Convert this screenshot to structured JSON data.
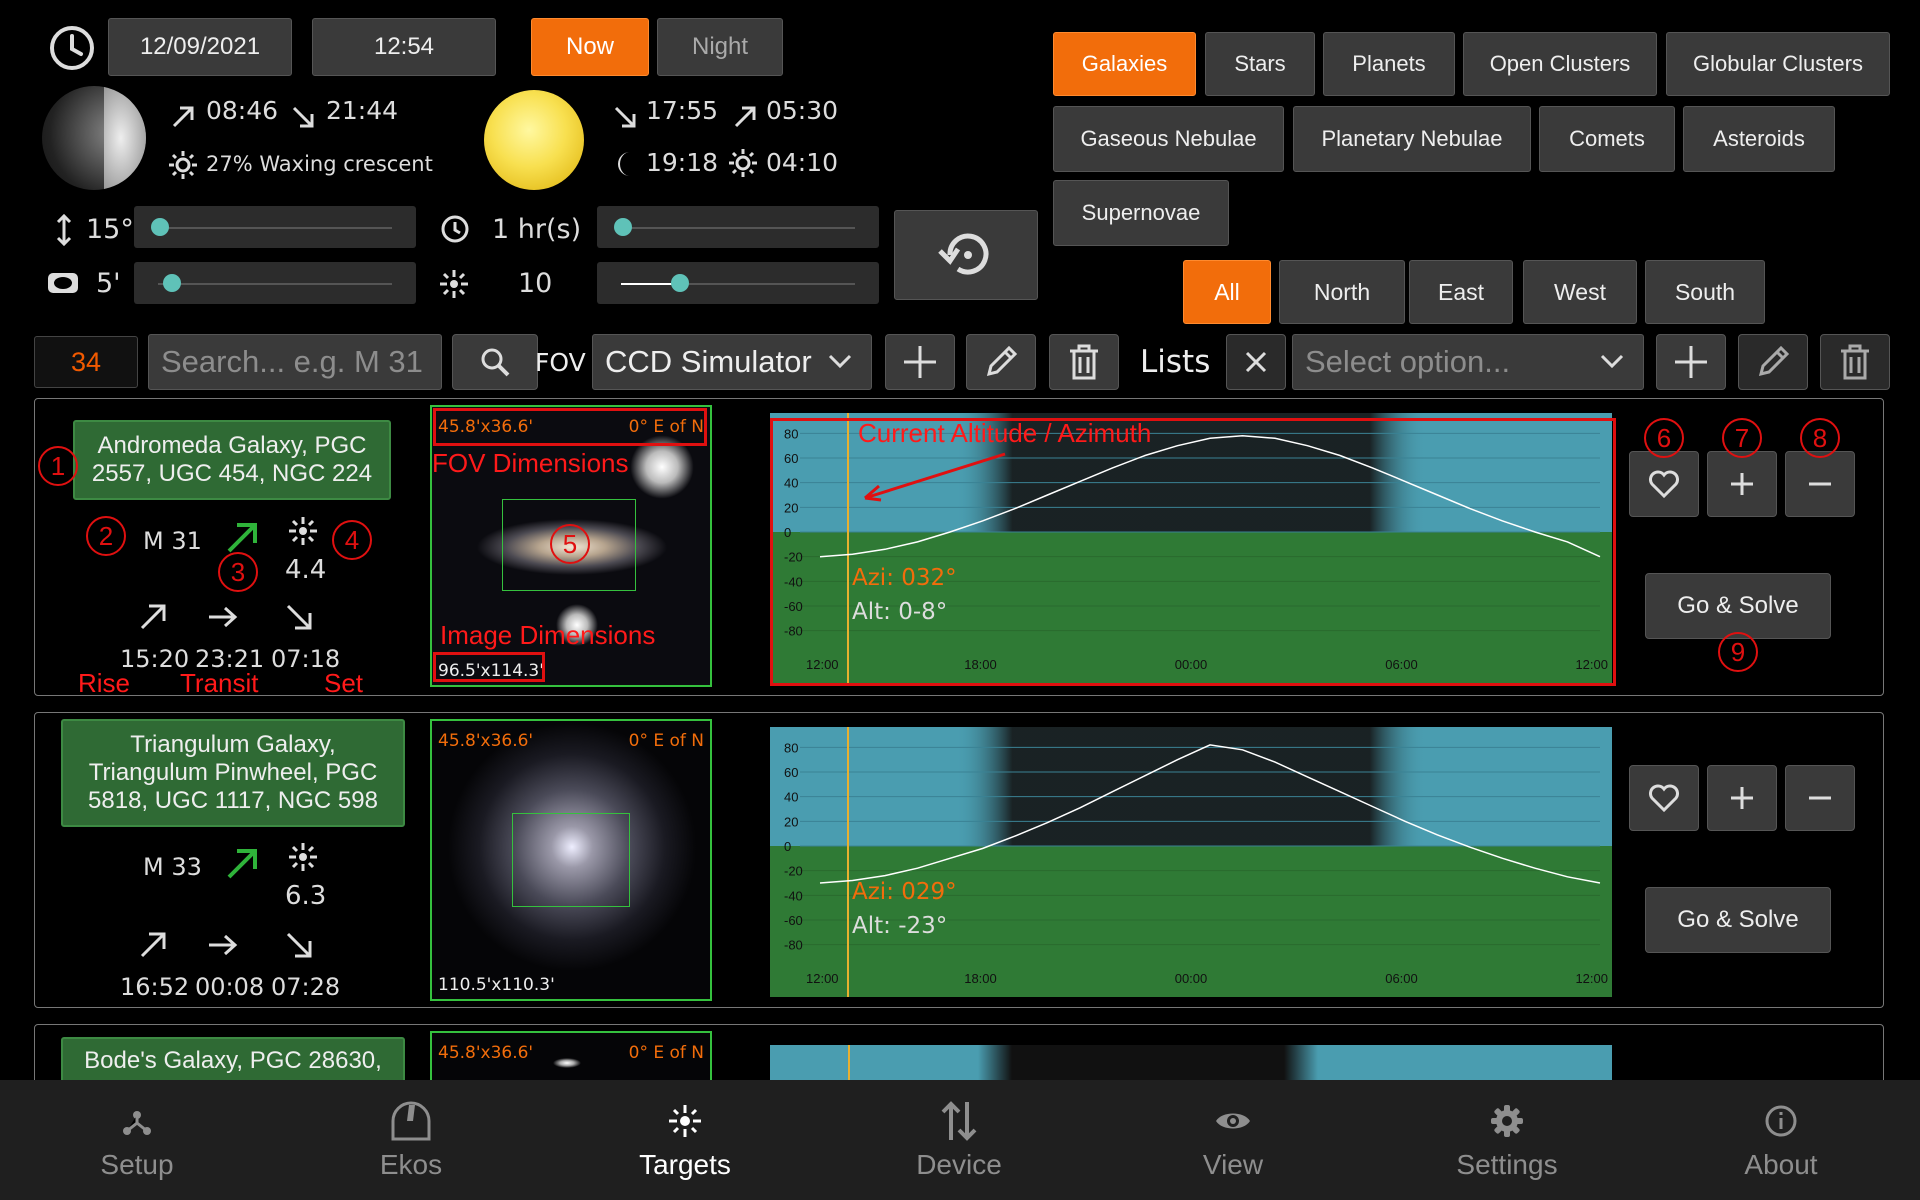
{
  "header": {
    "date": "12/09/2021",
    "time": "12:54",
    "now_label": "Now",
    "night_label": "Night"
  },
  "moon": {
    "rise": "08:46",
    "set": "21:44",
    "phase": "27% Waxing crescent"
  },
  "sun": {
    "set": "17:55",
    "rise": "05:30",
    "dusk": "19:18",
    "dawn": "04:10"
  },
  "filters": {
    "altitude": "15°",
    "duration": "1 hr(s)",
    "size": "5'",
    "magnitude": "10",
    "magnitude_fraction": 0.25
  },
  "categories": [
    "Galaxies",
    "Stars",
    "Planets",
    "Open Clusters",
    "Globular Clusters",
    "Gaseous Nebulae",
    "Planetary Nebulae",
    "Comets",
    "Asteroids",
    "Supernovae"
  ],
  "active_category": "Galaxies",
  "directions": [
    "All",
    "North",
    "East",
    "West",
    "South"
  ],
  "active_direction": "All",
  "toolbar": {
    "count": "34",
    "search_placeholder": "Search... e.g. M 31",
    "fov_label": "FOV",
    "fov_value": "CCD Simulator",
    "lists_label": "Lists",
    "lists_placeholder": "Select option..."
  },
  "targets": [
    {
      "name": "Andromeda Galaxy, PGC 2557, UGC 454, NGC 224",
      "id": "M 31",
      "magnitude": "4.4",
      "rise": "15:20",
      "transit": "23:21",
      "set": "07:18",
      "fov_dims": "45.8'x36.6'",
      "orientation": "0° E of N",
      "image_dims": "96.5'x114.3'",
      "azi": "Azi: 032°",
      "alt": "Alt: 0-8°",
      "go_label": "Go & Solve"
    },
    {
      "name": "Triangulum Galaxy, Triangulum Pinwheel, PGC 5818, UGC 1117, NGC 598",
      "id": "M 33",
      "magnitude": "6.3",
      "rise": "16:52",
      "transit": "00:08",
      "set": "07:28",
      "fov_dims": "45.8'x36.6'",
      "orientation": "0° E of N",
      "image_dims": "110.5'x110.3'",
      "azi": "Azi: 029°",
      "alt": "Alt: -23°",
      "go_label": "Go & Solve"
    },
    {
      "name": "Bode's Galaxy, PGC 28630,",
      "fov_dims": "45.8'x36.6'",
      "orientation": "0° E of N"
    }
  ],
  "annotations": {
    "current_alt_az": "Current Altitude / Azimuth",
    "fov_dimensions": "FOV Dimensions",
    "image_dimensions": "Image Dimensions",
    "rise": "Rise",
    "transit": "Transit",
    "set": "Set",
    "numbers": [
      "1",
      "2",
      "3",
      "4",
      "5",
      "6",
      "7",
      "8",
      "9"
    ]
  },
  "chart_data": [
    {
      "type": "line",
      "title": "",
      "xlabel": "",
      "ylabel": "",
      "x": [
        "12:00",
        "18:00",
        "00:00",
        "06:00",
        "12:00"
      ],
      "y_ticks": [
        "80",
        "60",
        "40",
        "20",
        "0",
        "-20",
        "-40",
        "-60",
        "-80"
      ],
      "ylim": [
        -90,
        90
      ],
      "series": [
        {
          "x_hours": [
            0,
            1,
            2,
            3,
            4,
            5,
            6,
            7,
            8,
            9,
            10,
            11,
            12,
            13,
            14,
            15,
            16,
            17,
            18,
            19,
            20,
            21,
            22,
            23,
            24
          ],
          "values": [
            -20,
            -18,
            -14,
            -8,
            0,
            9,
            19,
            30,
            41,
            52,
            62,
            70,
            76,
            78,
            76,
            70,
            62,
            52,
            41,
            30,
            19,
            9,
            0,
            -8,
            -20
          ]
        }
      ]
    },
    {
      "type": "line",
      "title": "",
      "xlabel": "",
      "ylabel": "",
      "x": [
        "12:00",
        "18:00",
        "00:00",
        "06:00",
        "12:00"
      ],
      "y_ticks": [
        "80",
        "60",
        "40",
        "20",
        "0",
        "-20",
        "-40",
        "-60",
        "-80"
      ],
      "ylim": [
        -90,
        90
      ],
      "series": [
        {
          "x_hours": [
            0,
            1,
            2,
            3,
            4,
            5,
            6,
            7,
            8,
            9,
            10,
            11,
            12,
            13,
            14,
            15,
            16,
            17,
            18,
            19,
            20,
            21,
            22,
            23,
            24
          ],
          "values": [
            -30,
            -28,
            -24,
            -18,
            -10,
            -2,
            8,
            19,
            31,
            44,
            57,
            70,
            82,
            78,
            68,
            56,
            44,
            32,
            20,
            9,
            -1,
            -10,
            -18,
            -25,
            -30
          ]
        }
      ]
    }
  ],
  "nav": [
    "Setup",
    "Ekos",
    "Targets",
    "Device",
    "View",
    "Settings",
    "About"
  ],
  "active_nav": "Targets",
  "colors": {
    "accent": "#f26d0b",
    "name_box": "#2f6a34",
    "sky": "#4a9db0",
    "ground": "#2f7a35",
    "slider_knob": "#5fc2b8"
  }
}
